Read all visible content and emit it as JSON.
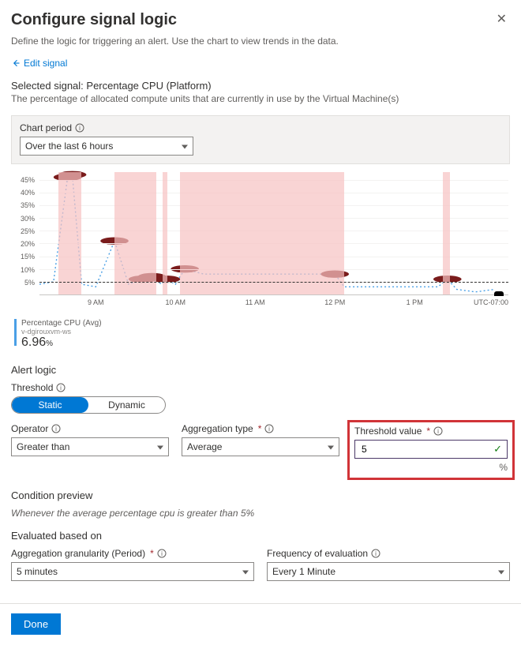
{
  "header": {
    "title": "Configure signal logic",
    "subtext": "Define the logic for triggering an alert. Use the chart to view trends in the data.",
    "edit_link": "Edit signal"
  },
  "signal": {
    "label_prefix": "Selected signal: ",
    "name": "Percentage CPU (Platform)",
    "description": "The percentage of allocated compute units that are currently in use by the Virtual Machine(s)"
  },
  "chart_period": {
    "label": "Chart period",
    "value": "Over the last 6 hours"
  },
  "chart_data": {
    "type": "line",
    "title": "",
    "ylabel": "",
    "xlabel": "",
    "y_ticks": [
      "5%",
      "10%",
      "15%",
      "20%",
      "25%",
      "30%",
      "35%",
      "40%",
      "45%"
    ],
    "y_max_pct": 48,
    "threshold_pct": 5,
    "x_ticks": [
      {
        "label": "9 AM",
        "x": 12
      },
      {
        "label": "10 AM",
        "x": 29
      },
      {
        "label": "11 AM",
        "x": 46
      },
      {
        "label": "12 PM",
        "x": 63
      },
      {
        "label": "1 PM",
        "x": 80
      }
    ],
    "tz_label": "UTC-07:00",
    "highlight_bands_pct": [
      {
        "start": 4,
        "end": 9
      },
      {
        "start": 16,
        "end": 25
      },
      {
        "start": 26.2,
        "end": 27.2
      },
      {
        "start": 30,
        "end": 65
      },
      {
        "start": 86,
        "end": 87.5
      }
    ],
    "series": [
      {
        "name": "Percentage CPU (Avg)",
        "resource": "v-dgirouxvm-ws",
        "points_pct": [
          {
            "x": 0,
            "y": 4
          },
          {
            "x": 3,
            "y": 5
          },
          {
            "x": 6,
            "y": 46
          },
          {
            "x": 7,
            "y": 47
          },
          {
            "x": 9,
            "y": 4
          },
          {
            "x": 12,
            "y": 3
          },
          {
            "x": 16,
            "y": 21
          },
          {
            "x": 19,
            "y": 4
          },
          {
            "x": 22,
            "y": 6
          },
          {
            "x": 24,
            "y": 7
          },
          {
            "x": 26,
            "y": 4
          },
          {
            "x": 27,
            "y": 6
          },
          {
            "x": 29,
            "y": 4
          },
          {
            "x": 31,
            "y": 10
          },
          {
            "x": 35,
            "y": 8
          },
          {
            "x": 41,
            "y": 8
          },
          {
            "x": 47,
            "y": 8
          },
          {
            "x": 53,
            "y": 8
          },
          {
            "x": 59,
            "y": 8
          },
          {
            "x": 63,
            "y": 8
          },
          {
            "x": 65,
            "y": 3
          },
          {
            "x": 72,
            "y": 3
          },
          {
            "x": 80,
            "y": 3
          },
          {
            "x": 85,
            "y": 3
          },
          {
            "x": 87,
            "y": 6
          },
          {
            "x": 89,
            "y": 2
          },
          {
            "x": 93,
            "y": 1
          },
          {
            "x": 97,
            "y": 2
          }
        ],
        "markers_pct": [
          {
            "x": 6,
            "y": 46
          },
          {
            "x": 7,
            "y": 47
          },
          {
            "x": 16,
            "y": 21
          },
          {
            "x": 22,
            "y": 6
          },
          {
            "x": 24,
            "y": 7
          },
          {
            "x": 27,
            "y": 6
          },
          {
            "x": 31,
            "y": 10
          },
          {
            "x": 63,
            "y": 8
          },
          {
            "x": 87,
            "y": 6
          }
        ],
        "current_marker_x": 98
      }
    ]
  },
  "legend": {
    "metric": "Percentage CPU (Avg)",
    "resource": "v-dgirouxvm-ws",
    "value": "6.96",
    "unit": "%"
  },
  "alert_logic": {
    "heading": "Alert logic",
    "threshold_label": "Threshold",
    "toggle": {
      "static": "Static",
      "dynamic": "Dynamic",
      "active": "static"
    },
    "operator": {
      "label": "Operator",
      "value": "Greater than"
    },
    "aggregation": {
      "label": "Aggregation type",
      "value": "Average"
    },
    "threshold_value": {
      "label": "Threshold value",
      "value": "5",
      "unit": "%"
    }
  },
  "condition_preview": {
    "heading": "Condition preview",
    "text": "Whenever the average percentage cpu is greater than 5%"
  },
  "evaluated": {
    "heading": "Evaluated based on",
    "granularity": {
      "label": "Aggregation granularity (Period)",
      "value": "5 minutes"
    },
    "frequency": {
      "label": "Frequency of evaluation",
      "value": "Every 1 Minute"
    }
  },
  "footer": {
    "done": "Done"
  }
}
